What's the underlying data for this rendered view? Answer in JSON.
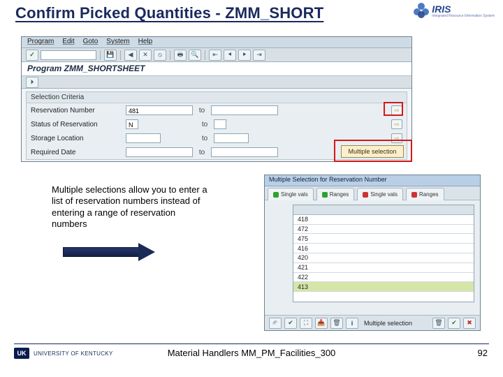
{
  "slide": {
    "title": "Confirm Picked Quantities - ZMM_SHORT",
    "iris": {
      "word": "IRIS",
      "sub": "Integrated Resource Information System"
    }
  },
  "sap1": {
    "menu": {
      "m0": "Program",
      "m1": "Edit",
      "m2": "Goto",
      "m3": "System",
      "m4": "Help"
    },
    "program_header": "Program ZMM_SHORTSHEET",
    "group_title": "Selection Criteria",
    "rows": {
      "r0": {
        "label": "Reservation Number",
        "v1": "481",
        "to": "to"
      },
      "r1": {
        "label": "Status of Reservation",
        "v1": "N",
        "to": "to"
      },
      "r2": {
        "label": "Storage Location",
        "to": "to"
      },
      "r3": {
        "label": "Required Date",
        "to": "to"
      }
    },
    "callout": "Multiple selection"
  },
  "note": "Multiple selections allow you to enter a list of reservation numbers instead of entering a range of reservation numbers",
  "sap2": {
    "title": "Multiple Selection for Reservation Number",
    "tabs": {
      "t0": "Single vals",
      "t1": "Ranges",
      "t2": "Single vals",
      "t3": "Ranges"
    },
    "vals": [
      "418",
      "472",
      "475",
      "416",
      "420",
      "421",
      "422",
      "413"
    ],
    "bottom_label": "Multiple selection"
  },
  "footer": {
    "uk_badge": "UK",
    "uk_text": "UNIVERSITY OF KENTUCKY",
    "center": "Material Handlers MM_PM_Facilities_300",
    "page": "92"
  }
}
